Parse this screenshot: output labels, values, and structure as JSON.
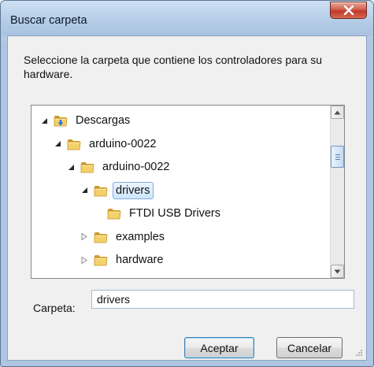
{
  "window": {
    "title": "Buscar carpeta",
    "close_label": "x"
  },
  "dialog": {
    "instruction": "Seleccione la carpeta que contiene los controladores para su hardware."
  },
  "tree": {
    "nodes": [
      {
        "label": "Descargas",
        "level": 0,
        "expander": "expanded",
        "icon": "downloads-folder-icon",
        "selected": false
      },
      {
        "label": "arduino-0022",
        "level": 1,
        "expander": "expanded",
        "icon": "folder-icon",
        "selected": false
      },
      {
        "label": "arduino-0022",
        "level": 2,
        "expander": "expanded",
        "icon": "folder-icon",
        "selected": false
      },
      {
        "label": "drivers",
        "level": 3,
        "expander": "expanded",
        "icon": "folder-icon",
        "selected": true
      },
      {
        "label": "FTDI USB Drivers",
        "level": 4,
        "expander": "none",
        "icon": "folder-icon",
        "selected": false
      },
      {
        "label": "examples",
        "level": 3,
        "expander": "collapsed",
        "icon": "folder-icon",
        "selected": false
      },
      {
        "label": "hardware",
        "level": 3,
        "expander": "collapsed",
        "icon": "folder-icon",
        "selected": false
      }
    ]
  },
  "folder_field": {
    "label": "Carpeta:",
    "value": "drivers"
  },
  "buttons": {
    "accept": "Aceptar",
    "cancel": "Cancelar"
  },
  "colors": {
    "title_bar": "#b6cde8",
    "close_button": "#c0392b",
    "selection_border": "#84acdd",
    "folder_yellow": "#e8c35a"
  }
}
